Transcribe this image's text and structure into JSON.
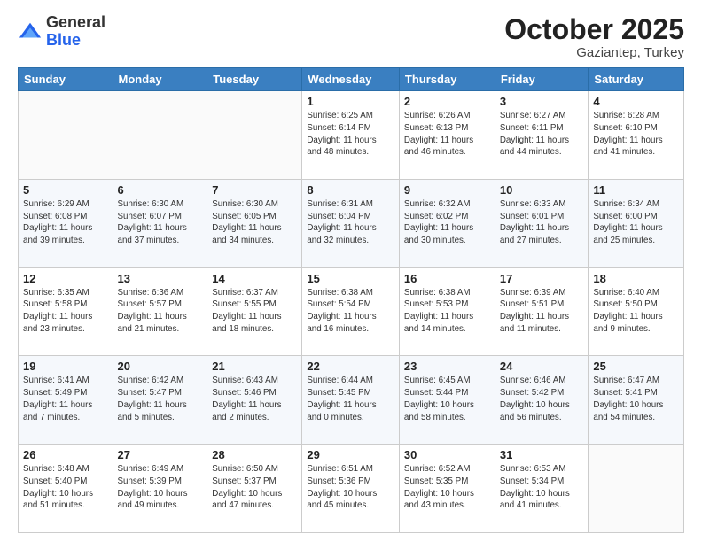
{
  "logo": {
    "general": "General",
    "blue": "Blue"
  },
  "header": {
    "month": "October 2025",
    "location": "Gaziantep, Turkey"
  },
  "weekdays": [
    "Sunday",
    "Monday",
    "Tuesday",
    "Wednesday",
    "Thursday",
    "Friday",
    "Saturday"
  ],
  "weeks": [
    [
      {
        "day": "",
        "info": ""
      },
      {
        "day": "",
        "info": ""
      },
      {
        "day": "",
        "info": ""
      },
      {
        "day": "1",
        "info": "Sunrise: 6:25 AM\nSunset: 6:14 PM\nDaylight: 11 hours\nand 48 minutes."
      },
      {
        "day": "2",
        "info": "Sunrise: 6:26 AM\nSunset: 6:13 PM\nDaylight: 11 hours\nand 46 minutes."
      },
      {
        "day": "3",
        "info": "Sunrise: 6:27 AM\nSunset: 6:11 PM\nDaylight: 11 hours\nand 44 minutes."
      },
      {
        "day": "4",
        "info": "Sunrise: 6:28 AM\nSunset: 6:10 PM\nDaylight: 11 hours\nand 41 minutes."
      }
    ],
    [
      {
        "day": "5",
        "info": "Sunrise: 6:29 AM\nSunset: 6:08 PM\nDaylight: 11 hours\nand 39 minutes."
      },
      {
        "day": "6",
        "info": "Sunrise: 6:30 AM\nSunset: 6:07 PM\nDaylight: 11 hours\nand 37 minutes."
      },
      {
        "day": "7",
        "info": "Sunrise: 6:30 AM\nSunset: 6:05 PM\nDaylight: 11 hours\nand 34 minutes."
      },
      {
        "day": "8",
        "info": "Sunrise: 6:31 AM\nSunset: 6:04 PM\nDaylight: 11 hours\nand 32 minutes."
      },
      {
        "day": "9",
        "info": "Sunrise: 6:32 AM\nSunset: 6:02 PM\nDaylight: 11 hours\nand 30 minutes."
      },
      {
        "day": "10",
        "info": "Sunrise: 6:33 AM\nSunset: 6:01 PM\nDaylight: 11 hours\nand 27 minutes."
      },
      {
        "day": "11",
        "info": "Sunrise: 6:34 AM\nSunset: 6:00 PM\nDaylight: 11 hours\nand 25 minutes."
      }
    ],
    [
      {
        "day": "12",
        "info": "Sunrise: 6:35 AM\nSunset: 5:58 PM\nDaylight: 11 hours\nand 23 minutes."
      },
      {
        "day": "13",
        "info": "Sunrise: 6:36 AM\nSunset: 5:57 PM\nDaylight: 11 hours\nand 21 minutes."
      },
      {
        "day": "14",
        "info": "Sunrise: 6:37 AM\nSunset: 5:55 PM\nDaylight: 11 hours\nand 18 minutes."
      },
      {
        "day": "15",
        "info": "Sunrise: 6:38 AM\nSunset: 5:54 PM\nDaylight: 11 hours\nand 16 minutes."
      },
      {
        "day": "16",
        "info": "Sunrise: 6:38 AM\nSunset: 5:53 PM\nDaylight: 11 hours\nand 14 minutes."
      },
      {
        "day": "17",
        "info": "Sunrise: 6:39 AM\nSunset: 5:51 PM\nDaylight: 11 hours\nand 11 minutes."
      },
      {
        "day": "18",
        "info": "Sunrise: 6:40 AM\nSunset: 5:50 PM\nDaylight: 11 hours\nand 9 minutes."
      }
    ],
    [
      {
        "day": "19",
        "info": "Sunrise: 6:41 AM\nSunset: 5:49 PM\nDaylight: 11 hours\nand 7 minutes."
      },
      {
        "day": "20",
        "info": "Sunrise: 6:42 AM\nSunset: 5:47 PM\nDaylight: 11 hours\nand 5 minutes."
      },
      {
        "day": "21",
        "info": "Sunrise: 6:43 AM\nSunset: 5:46 PM\nDaylight: 11 hours\nand 2 minutes."
      },
      {
        "day": "22",
        "info": "Sunrise: 6:44 AM\nSunset: 5:45 PM\nDaylight: 11 hours\nand 0 minutes."
      },
      {
        "day": "23",
        "info": "Sunrise: 6:45 AM\nSunset: 5:44 PM\nDaylight: 10 hours\nand 58 minutes."
      },
      {
        "day": "24",
        "info": "Sunrise: 6:46 AM\nSunset: 5:42 PM\nDaylight: 10 hours\nand 56 minutes."
      },
      {
        "day": "25",
        "info": "Sunrise: 6:47 AM\nSunset: 5:41 PM\nDaylight: 10 hours\nand 54 minutes."
      }
    ],
    [
      {
        "day": "26",
        "info": "Sunrise: 6:48 AM\nSunset: 5:40 PM\nDaylight: 10 hours\nand 51 minutes."
      },
      {
        "day": "27",
        "info": "Sunrise: 6:49 AM\nSunset: 5:39 PM\nDaylight: 10 hours\nand 49 minutes."
      },
      {
        "day": "28",
        "info": "Sunrise: 6:50 AM\nSunset: 5:37 PM\nDaylight: 10 hours\nand 47 minutes."
      },
      {
        "day": "29",
        "info": "Sunrise: 6:51 AM\nSunset: 5:36 PM\nDaylight: 10 hours\nand 45 minutes."
      },
      {
        "day": "30",
        "info": "Sunrise: 6:52 AM\nSunset: 5:35 PM\nDaylight: 10 hours\nand 43 minutes."
      },
      {
        "day": "31",
        "info": "Sunrise: 6:53 AM\nSunset: 5:34 PM\nDaylight: 10 hours\nand 41 minutes."
      },
      {
        "day": "",
        "info": ""
      }
    ]
  ]
}
